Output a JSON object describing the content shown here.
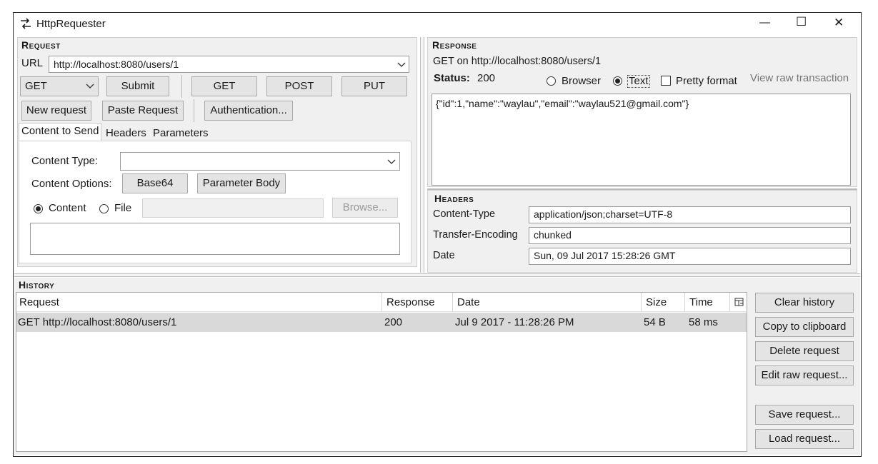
{
  "window": {
    "title": "HttpRequester",
    "minimize_glyph": "—",
    "maximize_glyph": "☐",
    "close_glyph": "✕"
  },
  "request": {
    "section_title": "Request",
    "url_label": "URL",
    "url_value": "http://localhost:8080/users/1",
    "method_selected": "GET",
    "submit_label": "Submit",
    "get_label": "GET",
    "post_label": "POST",
    "put_label": "PUT",
    "new_request_label": "New request",
    "paste_request_label": "Paste Request",
    "authentication_label": "Authentication...",
    "tabs": [
      "Content to Send",
      "Headers",
      "Parameters"
    ],
    "content_type_label": "Content Type:",
    "content_type_value": "",
    "content_options_label": "Content Options:",
    "base64_label": "Base64",
    "parameter_body_label": "Parameter Body",
    "content_radio_label": "Content",
    "file_radio_label": "File",
    "file_path_value": "",
    "browse_label": "Browse...",
    "content_body": ""
  },
  "response": {
    "section_title": "Response",
    "summary": "GET on http://localhost:8080/users/1",
    "status_label": "Status:",
    "status_value": "200",
    "browser_label": "Browser",
    "text_label": "Text",
    "pretty_format_label": "Pretty format",
    "view_raw_label": "View raw transaction",
    "body": "{\"id\":1,\"name\":\"waylau\",\"email\":\"waylau521@gmail.com\"}",
    "headers_title": "Headers",
    "headers": [
      {
        "name": "Content-Type",
        "value": "application/json;charset=UTF-8"
      },
      {
        "name": "Transfer-Encoding",
        "value": "chunked"
      },
      {
        "name": "Date",
        "value": "Sun, 09 Jul 2017 15:28:26 GMT"
      }
    ]
  },
  "history": {
    "section_title": "History",
    "columns": {
      "request": "Request",
      "response": "Response",
      "date": "Date",
      "size": "Size",
      "time": "Time"
    },
    "rows": [
      {
        "request": "GET http://localhost:8080/users/1",
        "response": "200",
        "date": "Jul 9 2017 - 11:28:26 PM",
        "size": "54 B",
        "time": "58 ms"
      }
    ],
    "clear_history_label": "Clear history",
    "copy_clipboard_label": "Copy to clipboard",
    "delete_request_label": "Delete request",
    "edit_raw_label": "Edit raw request...",
    "save_request_label": "Save request...",
    "load_request_label": "Load request..."
  }
}
